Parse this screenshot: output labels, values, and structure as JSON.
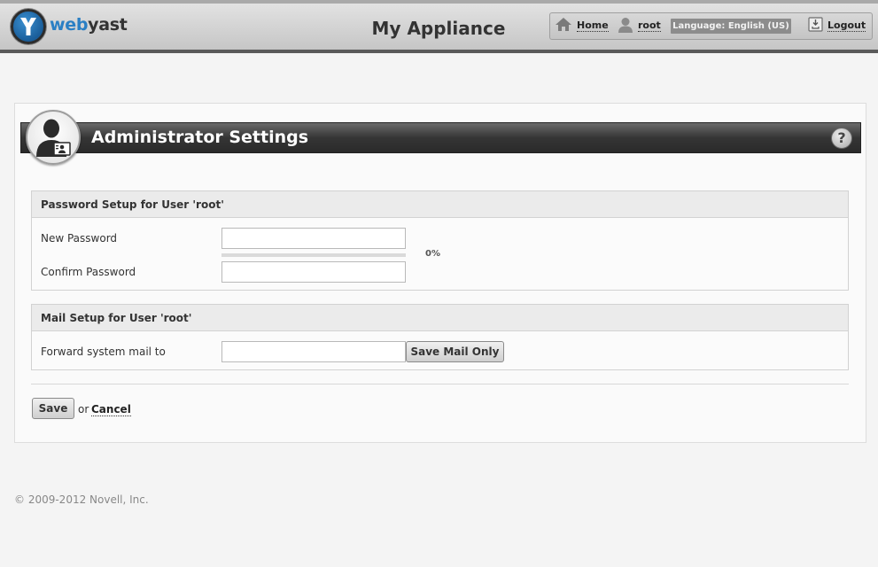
{
  "header": {
    "logo": {
      "web": "web",
      "yast": "yast"
    },
    "app_title": "My Appliance",
    "nav": {
      "home": "Home",
      "user": "root",
      "language": "Language: English (US)",
      "logout": "Logout"
    }
  },
  "page": {
    "title": "Administrator Settings",
    "help": "?"
  },
  "password_section": {
    "heading": "Password Setup for User 'root'",
    "new_password_label": "New Password",
    "new_password_value": "",
    "confirm_password_label": "Confirm Password",
    "confirm_password_value": "",
    "strength_percent": "0%"
  },
  "mail_section": {
    "heading": "Mail Setup for User 'root'",
    "forward_label": "Forward system mail to",
    "forward_value": "",
    "save_mail_button": "Save Mail Only"
  },
  "actions": {
    "save": "Save",
    "or": "or",
    "cancel": "Cancel"
  },
  "footer": {
    "copyright": "© 2009-2012 Novell, Inc."
  },
  "colors": {
    "brand_blue": "#2a7fc4",
    "title_bar": "#353535"
  }
}
